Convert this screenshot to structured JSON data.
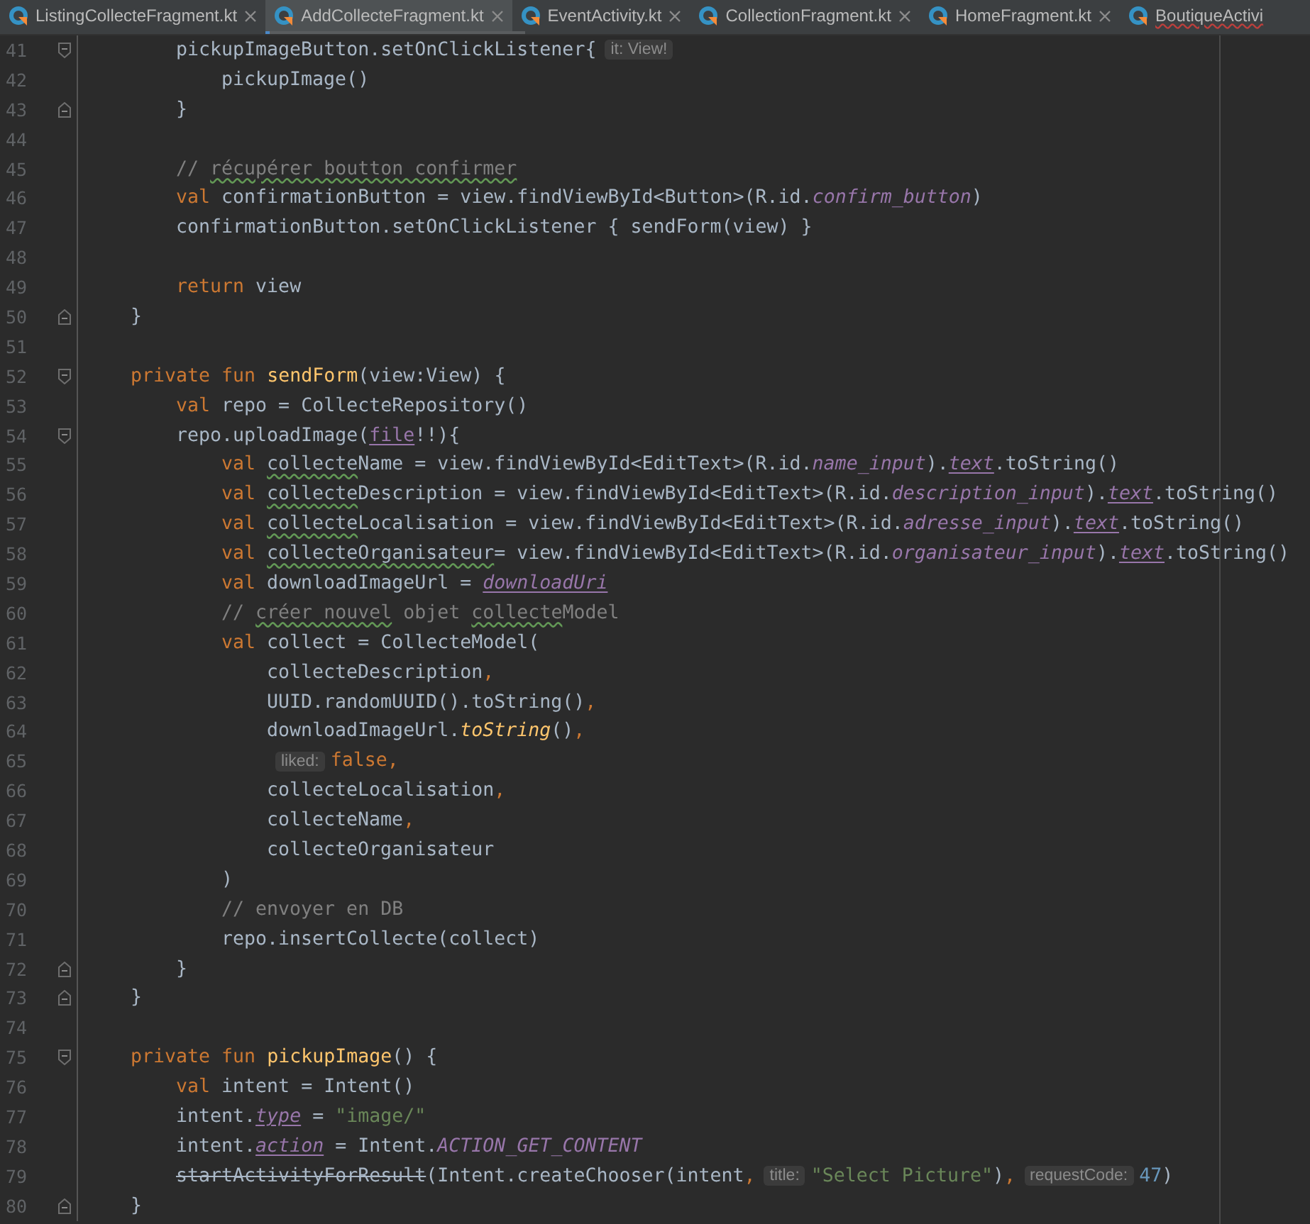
{
  "tabs": [
    {
      "label": "ListingCollecteFragment.kt",
      "selected": false,
      "error": false
    },
    {
      "label": "AddCollecteFragment.kt",
      "selected": true,
      "error": false
    },
    {
      "label": "EventActivity.kt",
      "selected": false,
      "error": false
    },
    {
      "label": "CollectionFragment.kt",
      "selected": false,
      "error": false
    },
    {
      "label": "HomeFragment.kt",
      "selected": false,
      "error": false
    },
    {
      "label": "BoutiqueActivi",
      "selected": false,
      "error": true
    }
  ],
  "lines": [
    {
      "kind": "block",
      "children": [
        {
          "number": "41",
          "kind": "fold-start",
          "tokens": [
            {
              "kind": "plain",
              "text": "pickupImageButton.setOnClickListener{"
            },
            {
              "kind": "hint",
              "text": "it: View!"
            }
          ],
          "children": [
            {
              "number": "42",
              "tokens": [
                {
                  "kind": "plain",
                  "text": "pickupImage()"
                }
              ]
            }
          ]
        },
        {
          "number": "43",
          "kind": "fold-end",
          "tokens": [
            {
              "kind": "plain",
              "text": "}"
            }
          ]
        },
        {
          "number": "44"
        },
        {
          "number": "45",
          "tokens": [
            {
              "kind": "comment",
              "text": "// "
            },
            {
              "kind": "comment",
              "text": "récupérer boutton confirmer",
              "typo": true
            }
          ]
        },
        {
          "number": "46",
          "tokens": [
            {
              "kind": "keyword",
              "text": "val "
            },
            {
              "kind": "plain",
              "text": "confirmationButton = view.findViewById<Button>(R.id."
            },
            {
              "kind": "constant",
              "text": "confirm_button"
            },
            {
              "kind": "plain",
              "text": ")"
            }
          ]
        },
        {
          "number": "47",
          "tokens": [
            {
              "kind": "plain",
              "text": "confirmationButton.setOnClickListener { sendForm(view) }"
            }
          ]
        },
        {
          "number": "48"
        },
        {
          "number": "49",
          "tokens": [
            {
              "kind": "keyword",
              "text": "return "
            },
            {
              "kind": "plain",
              "text": "view"
            }
          ]
        }
      ]
    },
    {
      "number": "50",
      "kind": "fold-end",
      "tokens": [
        {
          "kind": "plain",
          "text": "}"
        }
      ]
    },
    {
      "number": "51"
    },
    {
      "number": "52",
      "kind": "fold-start",
      "tokens": [
        {
          "kind": "keyword",
          "text": "private fun "
        },
        {
          "kind": "declaration",
          "text": "sendForm"
        },
        {
          "kind": "plain",
          "text": "(view:View) {"
        }
      ],
      "children": [
        {
          "number": "53",
          "tokens": [
            {
              "kind": "keyword",
              "text": "val "
            },
            {
              "kind": "plain",
              "text": "repo = CollecteRepository()"
            }
          ]
        },
        {
          "number": "54",
          "kind": "fold-start",
          "tokens": [
            {
              "kind": "plain",
              "text": "repo.uploadImage("
            },
            {
              "kind": "property",
              "text": "file",
              "underline": true
            },
            {
              "kind": "plain",
              "text": "!!){"
            }
          ],
          "children": [
            {
              "number": "55",
              "tokens": [
                {
                  "kind": "keyword",
                  "text": "val "
                },
                {
                  "kind": "plain",
                  "text": "collecte",
                  "typo": true
                },
                {
                  "kind": "plain",
                  "text": "Name = view.findViewById<EditText>(R.id."
                },
                {
                  "kind": "constant",
                  "text": "name_input"
                },
                {
                  "kind": "plain",
                  "text": ")."
                },
                {
                  "kind": "constant",
                  "text": "text",
                  "underline": true
                },
                {
                  "kind": "plain",
                  "text": ".toString()"
                }
              ]
            },
            {
              "number": "56",
              "tokens": [
                {
                  "kind": "keyword",
                  "text": "val "
                },
                {
                  "kind": "plain",
                  "text": "collecte",
                  "typo": true
                },
                {
                  "kind": "plain",
                  "text": "Description = view.findViewById<EditText>(R.id."
                },
                {
                  "kind": "constant",
                  "text": "description_input"
                },
                {
                  "kind": "plain",
                  "text": ")."
                },
                {
                  "kind": "constant",
                  "text": "text",
                  "underline": true
                },
                {
                  "kind": "plain",
                  "text": ".toString()"
                }
              ]
            },
            {
              "number": "57",
              "tokens": [
                {
                  "kind": "keyword",
                  "text": "val "
                },
                {
                  "kind": "plain",
                  "text": "collecte",
                  "typo": true
                },
                {
                  "kind": "plain",
                  "text": "Localisation = view.findViewById<EditText>(R.id."
                },
                {
                  "kind": "constant",
                  "text": "adresse_input"
                },
                {
                  "kind": "plain",
                  "text": ")."
                },
                {
                  "kind": "constant",
                  "text": "text",
                  "underline": true
                },
                {
                  "kind": "plain",
                  "text": ".toString()"
                }
              ]
            },
            {
              "number": "58",
              "tokens": [
                {
                  "kind": "keyword",
                  "text": "val "
                },
                {
                  "kind": "plain",
                  "text": "collecteOrganisateur",
                  "typo": true
                },
                {
                  "kind": "plain",
                  "text": "= view.findViewById<EditText>(R.id."
                },
                {
                  "kind": "constant",
                  "text": "organisateur_input"
                },
                {
                  "kind": "plain",
                  "text": ")."
                },
                {
                  "kind": "constant",
                  "text": "text",
                  "underline": true
                },
                {
                  "kind": "plain",
                  "text": ".toString()"
                }
              ]
            },
            {
              "number": "59",
              "tokens": [
                {
                  "kind": "keyword",
                  "text": "val "
                },
                {
                  "kind": "plain",
                  "text": "downloadImageUrl = "
                },
                {
                  "kind": "constant",
                  "text": "downloadUri",
                  "underline": true
                }
              ]
            },
            {
              "number": "60",
              "tokens": [
                {
                  "kind": "comment",
                  "text": "// "
                },
                {
                  "kind": "comment",
                  "text": "créer nouvel",
                  "typo": true
                },
                {
                  "kind": "comment",
                  "text": " objet "
                },
                {
                  "kind": "comment",
                  "text": "collecte",
                  "typo": true
                },
                {
                  "kind": "comment",
                  "text": "Model"
                }
              ]
            },
            {
              "number": "61",
              "tokens": [
                {
                  "kind": "keyword",
                  "text": "val "
                },
                {
                  "kind": "plain",
                  "text": "collect = CollecteModel("
                }
              ],
              "children": [
                {
                  "number": "62",
                  "tokens": [
                    {
                      "kind": "plain",
                      "text": "collecteDescription"
                    },
                    {
                      "kind": "keyword",
                      "text": ","
                    }
                  ]
                },
                {
                  "number": "63",
                  "tokens": [
                    {
                      "kind": "plain",
                      "text": "UUID.randomUUID().toString()"
                    },
                    {
                      "kind": "keyword",
                      "text": ","
                    }
                  ]
                },
                {
                  "number": "64",
                  "tokens": [
                    {
                      "kind": "plain",
                      "text": "downloadImageUrl."
                    },
                    {
                      "kind": "extension",
                      "text": "toString"
                    },
                    {
                      "kind": "plain",
                      "text": "()"
                    },
                    {
                      "kind": "keyword",
                      "text": ","
                    }
                  ]
                },
                {
                  "number": "65",
                  "tokens": [
                    {
                      "kind": "hint",
                      "text": "liked:"
                    },
                    {
                      "kind": "keyword",
                      "text": "false,"
                    }
                  ]
                },
                {
                  "number": "66",
                  "tokens": [
                    {
                      "kind": "plain",
                      "text": "collecteLocalisation"
                    },
                    {
                      "kind": "keyword",
                      "text": ","
                    }
                  ]
                },
                {
                  "number": "67",
                  "tokens": [
                    {
                      "kind": "plain",
                      "text": "collecteName"
                    },
                    {
                      "kind": "keyword",
                      "text": ","
                    }
                  ]
                },
                {
                  "number": "68",
                  "tokens": [
                    {
                      "kind": "plain",
                      "text": "collecteOrganisateur"
                    }
                  ]
                }
              ]
            },
            {
              "number": "69",
              "tokens": [
                {
                  "kind": "plain",
                  "text": ")"
                }
              ]
            },
            {
              "number": "70",
              "tokens": [
                {
                  "kind": "comment",
                  "text": "// envoyer en DB"
                }
              ]
            },
            {
              "number": "71",
              "tokens": [
                {
                  "kind": "plain",
                  "text": "repo.insertCollecte(collect)"
                }
              ]
            }
          ]
        },
        {
          "number": "72",
          "kind": "fold-end",
          "tokens": [
            {
              "kind": "plain",
              "text": "}"
            }
          ]
        }
      ]
    },
    {
      "number": "73",
      "kind": "fold-end",
      "tokens": [
        {
          "kind": "plain",
          "text": "}"
        }
      ]
    },
    {
      "number": "74"
    },
    {
      "number": "75",
      "kind": "fold-start",
      "tokens": [
        {
          "kind": "keyword",
          "text": "private fun "
        },
        {
          "kind": "declaration",
          "text": "pickupImage"
        },
        {
          "kind": "plain",
          "text": "() {"
        }
      ],
      "children": [
        {
          "number": "76",
          "tokens": [
            {
              "kind": "keyword",
              "text": "val "
            },
            {
              "kind": "plain",
              "text": "intent = Intent()"
            }
          ]
        },
        {
          "number": "77",
          "tokens": [
            {
              "kind": "plain",
              "text": "intent."
            },
            {
              "kind": "constant",
              "text": "type",
              "underline": true
            },
            {
              "kind": "plain",
              "text": " = "
            },
            {
              "kind": "string",
              "text": "\"image/\""
            }
          ]
        },
        {
          "number": "78",
          "tokens": [
            {
              "kind": "plain",
              "text": "intent."
            },
            {
              "kind": "constant",
              "text": "action",
              "underline": true
            },
            {
              "kind": "plain",
              "text": " = Intent."
            },
            {
              "kind": "constant",
              "text": "ACTION_GET_CONTENT"
            }
          ]
        },
        {
          "number": "79",
          "tokens": [
            {
              "kind": "plain",
              "text": "startActivityForResult",
              "strike": true
            },
            {
              "kind": "plain",
              "text": "(Intent.createChooser(intent"
            },
            {
              "kind": "keyword",
              "text": ","
            },
            {
              "kind": "hint",
              "text": "title:"
            },
            {
              "kind": "string",
              "text": "\"Select Picture\""
            },
            {
              "kind": "plain",
              "text": ")"
            },
            {
              "kind": "keyword",
              "text": ","
            },
            {
              "kind": "hint",
              "text": "requestCode:"
            },
            {
              "kind": "number",
              "text": "47"
            },
            {
              "kind": "plain",
              "text": ")"
            }
          ]
        }
      ]
    },
    {
      "number": "80",
      "kind": "fold-end",
      "tokens": [
        {
          "kind": "plain",
          "text": "}"
        }
      ]
    }
  ]
}
